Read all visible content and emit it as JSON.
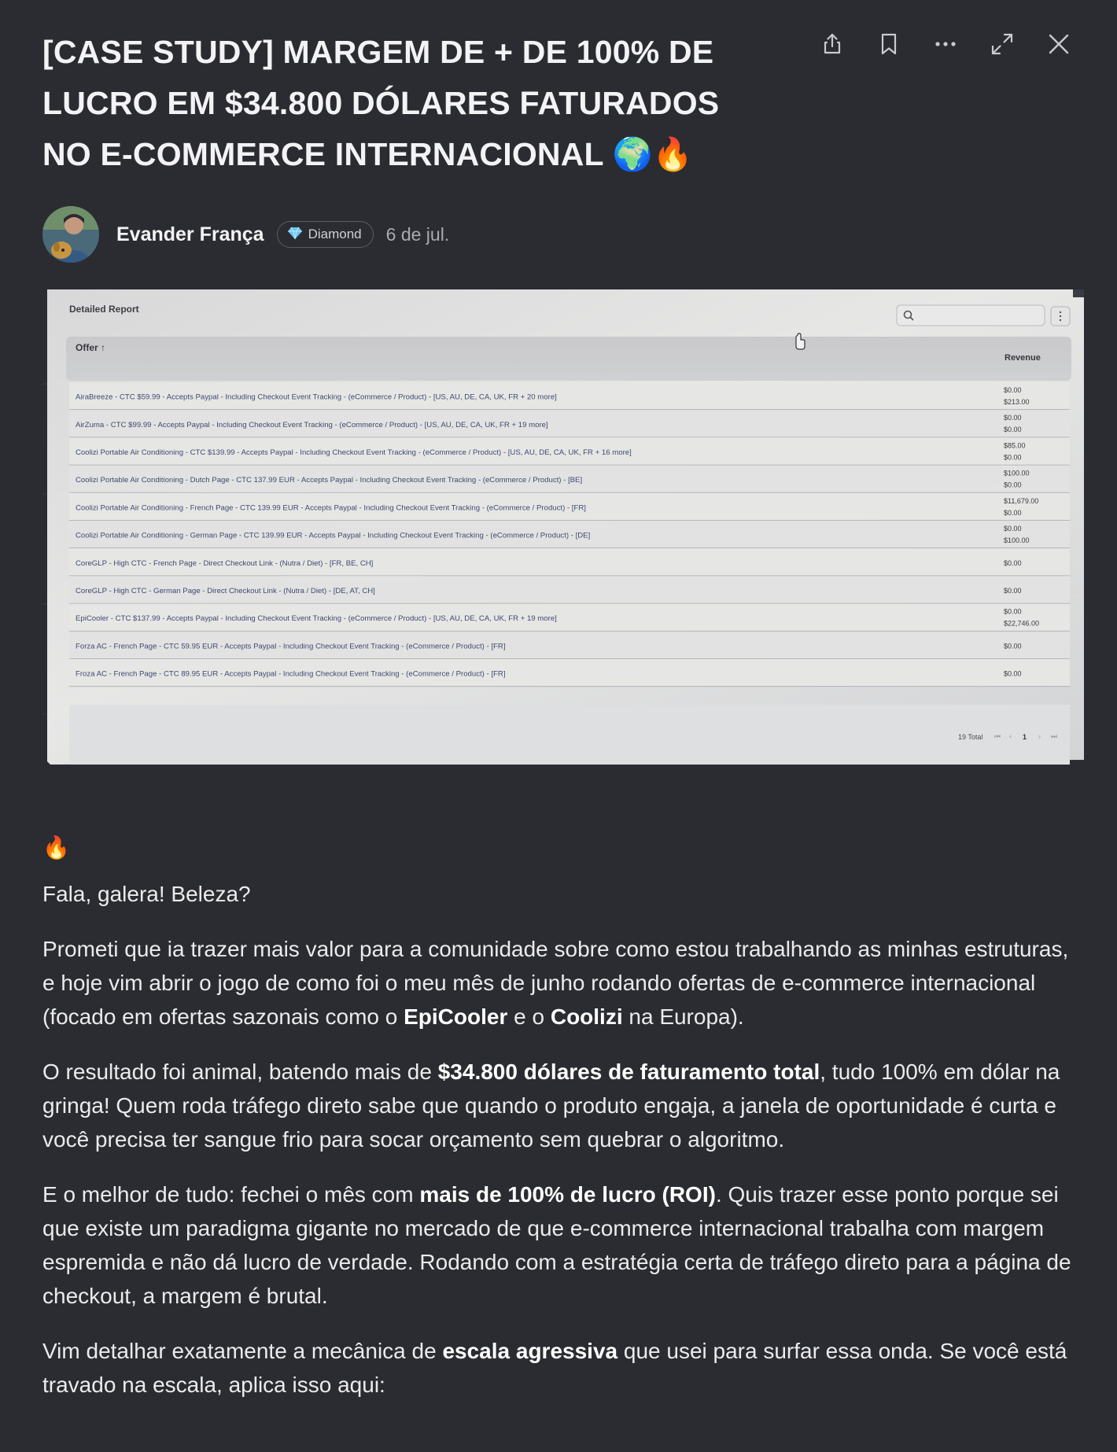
{
  "post": {
    "title": "[CASE STUDY] MARGEM DE + DE 100% DE LUCRO EM $34.800 DÓLARES FATURADOS NO E-COMMERCE INTERNACIONAL 🌍🔥",
    "author": "Evander França",
    "badge": "Diamond",
    "badge_icon": "diamond-icon",
    "date": "6 de jul."
  },
  "actions": [
    {
      "name": "share-icon"
    },
    {
      "name": "bookmark-icon"
    },
    {
      "name": "more-icon"
    },
    {
      "name": "expand-icon"
    },
    {
      "name": "close-icon"
    }
  ],
  "report": {
    "title": "Detailed Report",
    "column_offer": "Offer ↑",
    "column_revenue": "Revenue",
    "rows": [
      {
        "offer": "AiraBreeze - CTC $59.99 - Accepts Paypal - Including Checkout Event Tracking - (eCommerce / Product) - [US, AU, DE, CA, UK, FR + 20 more]",
        "rev1": "$0.00",
        "rev2": "$213.00"
      },
      {
        "offer": "AirZuma - CTC $99.99 - Accepts Paypal - Including Checkout Event Tracking - (eCommerce / Product) - [US, AU, DE, CA, UK, FR + 19 more]",
        "rev1": "$0.00",
        "rev2": "$0.00"
      },
      {
        "offer": "Coolizi Portable Air Conditioning - CTC $139.99 - Accepts Paypal - Including Checkout Event Tracking - (eCommerce / Product) - [US, AU, DE, CA, UK, FR + 16 more]",
        "rev1": "$85.00",
        "rev2": "$0.00"
      },
      {
        "offer": "Coolizi Portable Air Conditioning - Dutch Page - CTC 137.99 EUR - Accepts Paypal - Including Checkout Event Tracking - (eCommerce / Product) - [BE]",
        "rev1": "$100.00",
        "rev2": "$0.00"
      },
      {
        "offer": "Coolizi Portable Air Conditioning - French Page - CTC 139.99 EUR - Accepts Paypal - Including Checkout Event Tracking - (eCommerce / Product) - [FR]",
        "rev1": "$11,679.00",
        "rev2": "$0.00"
      },
      {
        "offer": "Coolizi Portable Air Conditioning - German Page - CTC 139.99 EUR - Accepts Paypal - Including Checkout Event Tracking - (eCommerce / Product) - [DE]",
        "rev1": "$0.00",
        "rev2": "$100.00"
      },
      {
        "offer": "CoreGLP - High CTC - French Page - Direct Checkout Link - (Nutra / Diet) - [FR, BE, CH]",
        "rev1": "$0.00",
        "rev2": ""
      },
      {
        "offer": "CoreGLP - High CTC - German Page - Direct Checkout Link - (Nutra / Diet) - [DE, AT, CH]",
        "rev1": "$0.00",
        "rev2": ""
      },
      {
        "offer": "EpiCooler - CTC $137.99 - Accepts Paypal - Including Checkout Event Tracking - (eCommerce / Product) - [US, AU, DE, CA, UK, FR + 19 more]",
        "rev1": "$0.00",
        "rev2": "$22,746.00"
      },
      {
        "offer": "Forza AC - French Page - CTC 59.95 EUR - Accepts Paypal - Including Checkout Event Tracking - (eCommerce / Product) - [FR]",
        "rev1": "$0.00",
        "rev2": ""
      },
      {
        "offer": "Froza AC - French Page - CTC 89.95 EUR - Accepts Paypal - Including Checkout Event Tracking - (eCommerce / Product) - [FR]",
        "rev1": "$0.00",
        "rev2": ""
      }
    ],
    "total": "19 Total",
    "page": "1"
  },
  "body": {
    "fire": "🔥",
    "greeting": "Fala, galera! Beleza?",
    "p1_a": "Prometi que ia trazer mais valor para a comunidade sobre como estou trabalhando as minhas estruturas, e hoje vim abrir o jogo de como foi o meu mês de junho rodando ofertas de e-commerce internacional (focado em ofertas sazonais como o ",
    "p1_b1": "EpiCooler",
    "p1_c": " e o ",
    "p1_b2": "Coolizi",
    "p1_d": " na Europa).",
    "p2_a": "O resultado foi animal, batendo mais de ",
    "p2_b": "$34.800 dólares de faturamento total",
    "p2_c": ", tudo 100% em dólar na gringa! Quem roda tráfego direto sabe que quando o produto engaja, a janela de oportunidade é curta e você precisa ter sangue frio para socar orçamento sem quebrar o algoritmo.",
    "p3_a": "E o melhor de tudo: fechei o mês com ",
    "p3_b": "mais de 100% de lucro (ROI)",
    "p3_c": ". Quis trazer esse ponto porque sei que existe um paradigma gigante no mercado de que e-commerce internacional trabalha com margem espremida e não dá lucro de verdade. Rodando com a estratégia certa de tráfego direto para a página de checkout, a margem é brutal.",
    "p4_a": "Vim detalhar exatamente a mecânica de ",
    "p4_b": "escala agressiva",
    "p4_c": " que usei para surfar essa onda. Se você está travado na escala, aplica isso aqui:"
  }
}
